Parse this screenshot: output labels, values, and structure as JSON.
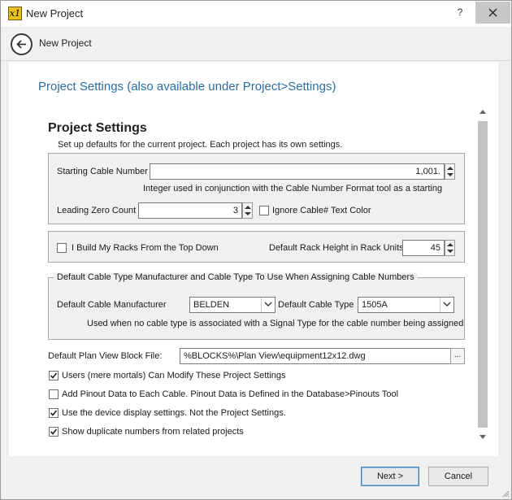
{
  "window": {
    "title": "New Project",
    "app_icon_text": "x1",
    "help_label": "?"
  },
  "header": {
    "label": "New Project"
  },
  "page": {
    "heading": "Project Settings (also available under Project>Settings)"
  },
  "panel": {
    "title": "Project Settings",
    "subtitle": "Set up defaults for the current project. Each project has its own settings."
  },
  "cable_numbers": {
    "starting_label": "Starting Cable Number",
    "starting_value": "1,001.",
    "starting_hint": "Integer used in conjunction with the Cable Number Format tool as a starting",
    "leading_zero_label": "Leading Zero Count",
    "leading_zero_value": "3",
    "ignore_color_label": "Ignore Cable# Text Color",
    "ignore_color_checked": false
  },
  "racks": {
    "top_down_label": "I Build My Racks From the Top Down",
    "top_down_checked": false,
    "rack_height_label": "Default Rack Height in Rack Units",
    "rack_height_value": "45"
  },
  "cable_type": {
    "legend": "Default Cable Type Manufacturer and Cable Type To Use When Assigning Cable Numbers",
    "manufacturer_label": "Default Cable Manufacturer",
    "manufacturer_value": "BELDEN",
    "type_label": "Default Cable Type",
    "type_value": "1505A",
    "hint": "Used when no cable type is associated with a Signal Type for the cable number being assigned"
  },
  "block_file": {
    "label": "Default Plan View Block File:",
    "value": "%BLOCKS%\\Plan View\\equipment12x12.dwg",
    "browse_label": "..."
  },
  "options": [
    {
      "label": "Users (mere mortals) Can Modify These Project Settings",
      "checked": true
    },
    {
      "label": "Add Pinout Data to Each Cable. Pinout Data is Defined in the Database>Pinouts Tool",
      "checked": false
    },
    {
      "label": "Use the device display settings. Not the Project Settings.",
      "checked": true
    },
    {
      "label": "Show duplicate numbers from related projects",
      "checked": true
    }
  ],
  "footer": {
    "next_label": "Next >",
    "cancel_label": "Cancel"
  },
  "colors": {
    "heading_blue": "#2a6ea6",
    "close_hover": "#c7c7c7",
    "primary_border": "#3c7fb1"
  }
}
